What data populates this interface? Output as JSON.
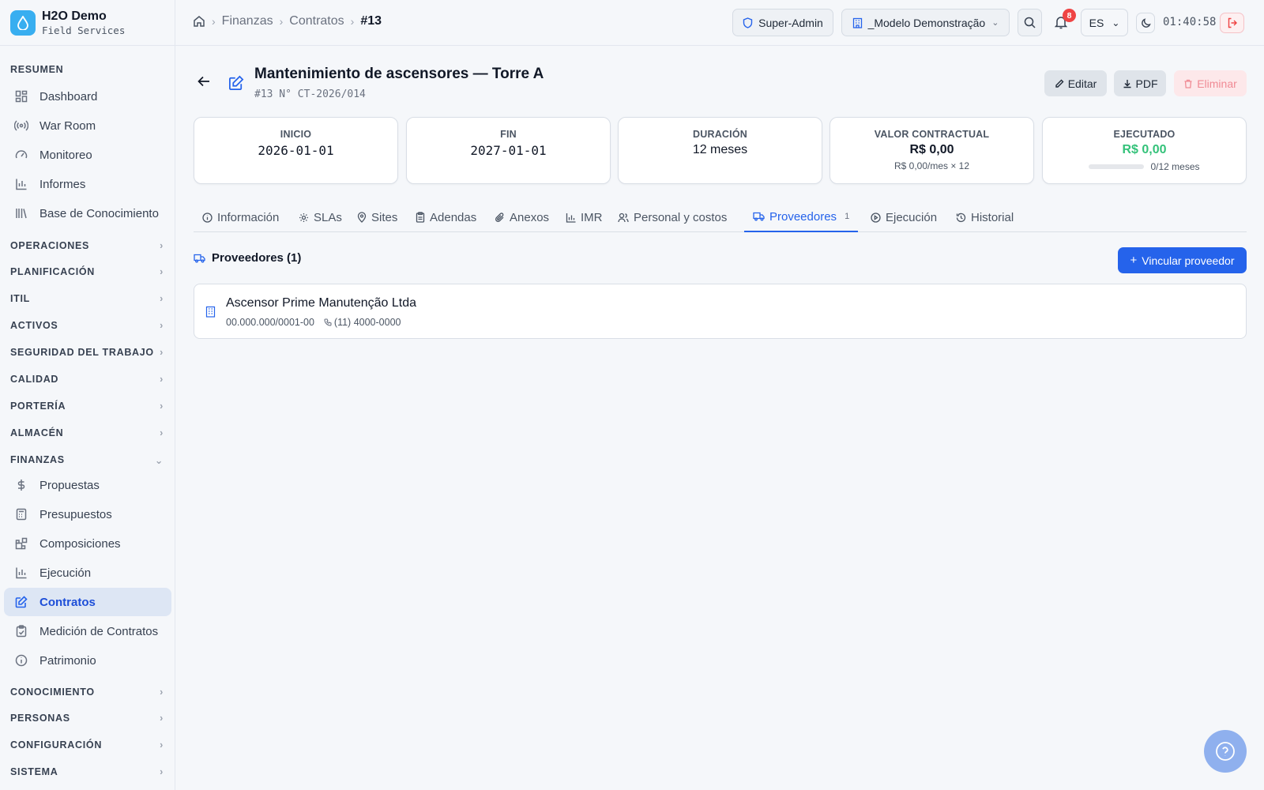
{
  "brand": {
    "name": "H2O Demo",
    "subtitle": "Field Services"
  },
  "sidebar": {
    "resumen_label": "RESUMEN",
    "resumen_items": [
      "Dashboard",
      "War Room",
      "Monitoreo",
      "Informes",
      "Base de Conocimiento"
    ],
    "sections": [
      "OPERACIONES",
      "PLANIFICACIÓN",
      "ITIL",
      "ACTIVOS",
      "SEGURIDAD DEL TRABAJO",
      "CALIDAD",
      "PORTERÍA",
      "ALMACÉN"
    ],
    "finanzas_label": "FINANZAS",
    "finanzas_items": [
      "Propuestas",
      "Presupuestos",
      "Composiciones",
      "Ejecución",
      "Contratos",
      "Medición de Contratos",
      "Patrimonio"
    ],
    "bottom_sections": [
      "CONOCIMIENTO",
      "PERSONAS",
      "CONFIGURACIÓN",
      "SISTEMA"
    ]
  },
  "topbar": {
    "breadcrumb": [
      "Finanzas",
      "Contratos",
      "#13"
    ],
    "role": "Super-Admin",
    "tenant": "_Modelo Demonstração",
    "notifications": "8",
    "language": "ES",
    "clock": "01:40:58"
  },
  "header": {
    "title": "Mantenimiento de ascensores — Torre A",
    "subtitle": "#13 N° CT-2026/014",
    "edit_label": "Editar",
    "pdf_label": "PDF",
    "delete_label": "Eliminar"
  },
  "stats": {
    "inicio": {
      "label": "INICIO",
      "value": "2026-01-01"
    },
    "fin": {
      "label": "FIN",
      "value": "2027-01-01"
    },
    "duracion": {
      "label": "DURACIÓN",
      "value": "12 meses"
    },
    "valor": {
      "label": "VALOR CONTRACTUAL",
      "value": "R$ 0,00",
      "sub": "R$ 0,00/mes × 12"
    },
    "ejecutado": {
      "label": "EJECUTADO",
      "value": "R$ 0,00",
      "progress_text": "0/12 meses",
      "progress_fraction": 0
    }
  },
  "tabs": [
    "Información",
    "SLAs",
    "Sites",
    "Adendas",
    "Anexos",
    "IMR",
    "Personal y costos",
    "Proveedores",
    "Ejecución",
    "Historial"
  ],
  "tab_active_count": "1",
  "panel": {
    "title": "Proveedores (1)",
    "add_button": "Vincular proveedor",
    "vendor": {
      "name": "Ascensor Prime Manutenção Ltda",
      "tax_id": "00.000.000/0001-00",
      "phone": "(11) 4000-0000"
    }
  },
  "colors": {
    "accent": "#2563eb",
    "success": "#34c27a",
    "danger": "#ef4444",
    "brand": "#38aef0"
  }
}
